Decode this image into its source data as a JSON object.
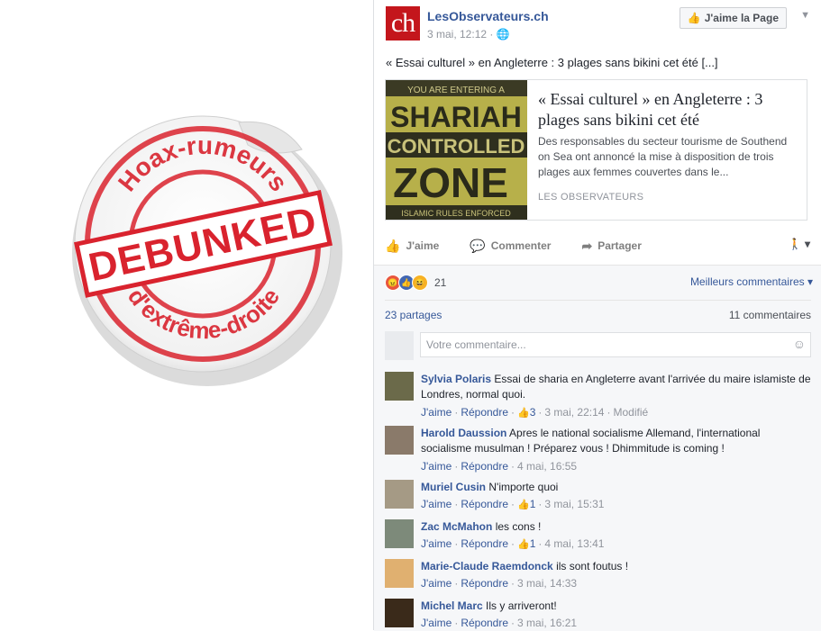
{
  "sticker": {
    "top_text": "Hoax-rumeurs",
    "center_text": "DEBUNKED",
    "bottom_text": "d'extrême-droite"
  },
  "post": {
    "page_name": "LesObservateurs.ch",
    "logo_text": "ch",
    "time": "3 mai, 12:12 · ",
    "like_page_label": "J'aime la Page",
    "text": "« Essai culturel » en Angleterre : 3 plages sans bikini cet été [...]",
    "link": {
      "image_lines": [
        "YOU ARE ENTERING A",
        "SHARIAH",
        "CONTROLLED",
        "ZONE",
        "ISLAMIC RULES ENFORCED"
      ],
      "title": "« Essai culturel » en Angleterre : 3 plages sans bikini cet été",
      "description": "Des responsables du secteur tourisme de Southend on Sea ont annoncé la mise à disposition de trois plages aux femmes couvertes dans le...",
      "source": "LES OBSERVATEURS"
    },
    "actions": {
      "like": "J'aime",
      "comment": "Commenter",
      "share": "Partager"
    },
    "reactions_count": "21",
    "top_comments_label": "Meilleurs commentaires",
    "shares_label": "23 partages",
    "comments_count_label": "11 commentaires",
    "composer_placeholder": "Votre commentaire..."
  },
  "comments": [
    {
      "name": "Sylvia Polaris",
      "text": "Essai de sharia en Angleterre avant l'arrivée du maire islamiste de Londres, normal quoi.",
      "like": "J'aime",
      "reply": "Répondre",
      "likes": "3",
      "time": "3 mai, 22:14",
      "edited": "Modifié"
    },
    {
      "name": "Harold Daussion",
      "text": "Apres le national socialisme Allemand, l'international socialisme musulman ! Préparez vous ! Dhimmitude is coming !",
      "like": "J'aime",
      "reply": "Répondre",
      "likes": "",
      "time": "4 mai, 16:55",
      "edited": ""
    },
    {
      "name": "Muriel Cusin",
      "text": "N'importe quoi",
      "like": "J'aime",
      "reply": "Répondre",
      "likes": "1",
      "time": "3 mai, 15:31",
      "edited": ""
    },
    {
      "name": "Zac McMahon",
      "text": "les cons !",
      "like": "J'aime",
      "reply": "Répondre",
      "likes": "1",
      "time": "4 mai, 13:41",
      "edited": ""
    },
    {
      "name": "Marie-Claude Raemdonck",
      "text": "ils sont foutus !",
      "like": "J'aime",
      "reply": "Répondre",
      "likes": "",
      "time": "3 mai, 14:33",
      "edited": ""
    },
    {
      "name": "Michel Marc",
      "text": "Ils y arriveront!",
      "like": "J'aime",
      "reply": "Répondre",
      "likes": "",
      "time": "3 mai, 16:21",
      "edited": ""
    }
  ],
  "colors": {
    "fb_blue": "#365899",
    "stamp_red": "#d9232e",
    "logo_red": "#c4161c"
  }
}
